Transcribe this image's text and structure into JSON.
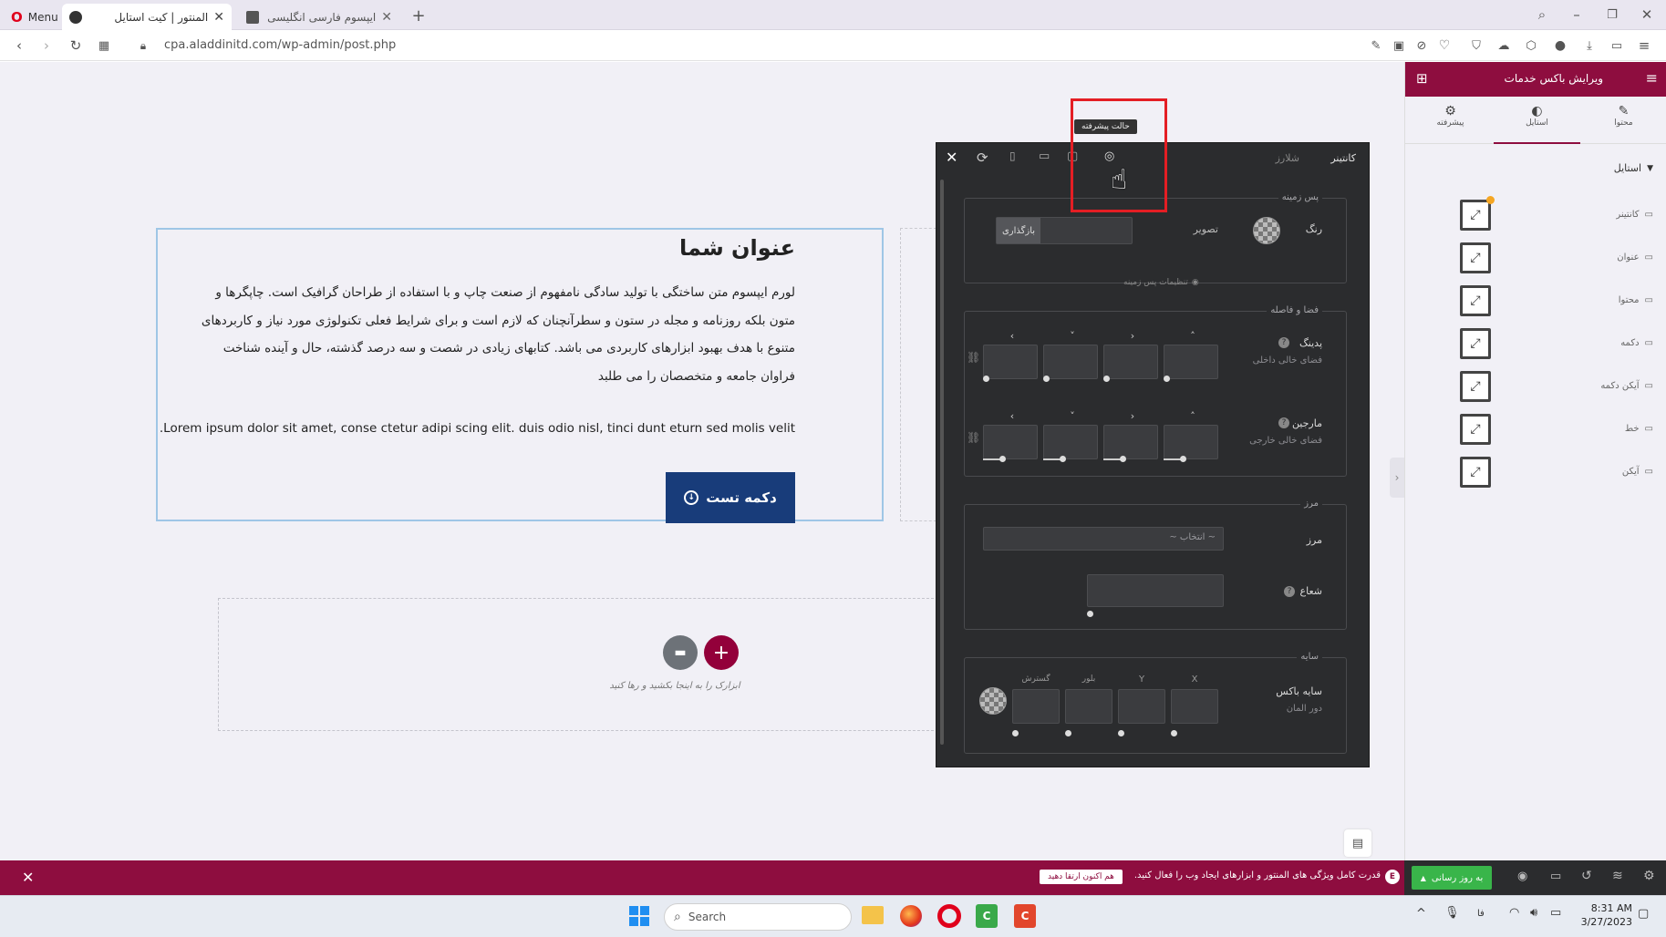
{
  "browser": {
    "menu_label": "Menu",
    "tabs": [
      {
        "label": "المنتور | کیت استایل"
      },
      {
        "label": "ایپسوم فارسی انگلیسی عربی"
      }
    ],
    "url": "cpa.aladdinitd.com/wp-admin/post.php"
  },
  "content": {
    "heading": "عنوان شما",
    "paragraph_lines": [
      "لورم ایپسوم متن ساختگی با تولید سادگی نامفهوم از صنعت چاپ و با استفاده از طراحان گرافیک است. چاپگرها و",
      "متون بلکه روزنامه و مجله در ستون و سطرآنچنان که لازم است و برای شرایط فعلی تکنولوژی مورد نیاز و کاربردهای",
      "متنوع با هدف بهبود ابزارهای کاربردی می باشد. کتابهای زیادی در شصت و سه درصد گذشته، حال و آینده شناخت",
      "فراوان جامعه و متخصصان را می طلبد"
    ],
    "latin_line": ".Lorem ipsum dolor sit amet, conse ctetur adipi scing elit. duis odio nisl, tinci dunt eturn sed molis velit",
    "button_label": "دکمه تست",
    "drop_hint": "ابزارک را به اینجا بکشید و رها کنید"
  },
  "modal": {
    "tab_container": "کانتینر",
    "tab_styler": "شلارز",
    "tooltip": "حالت پیشرفته",
    "background": {
      "title": "پس زمینه",
      "color_label": "رنگ",
      "image_label": "تصویر",
      "reset_label": "بازگذاری",
      "settings_note": "تنظیمات پس زمینه"
    },
    "spacing": {
      "title": "فضا و فاصله",
      "padding_label": "پدینگ",
      "padding_sub": "فضای خالی داخلی",
      "margin_label": "مارجین",
      "margin_sub": "فضای خالی خارجی",
      "arrows": [
        "‹",
        "˅",
        "›",
        "˄"
      ]
    },
    "border": {
      "title": "مرز",
      "border_label": "مرز",
      "select_value": "~ انتخاب ~",
      "radius_label": "شعاع"
    },
    "shadow": {
      "title": "سایه",
      "label": "سایه باکس",
      "sub": "دور المان",
      "cols": [
        "گسترش",
        "بلور",
        "Y",
        "X"
      ]
    }
  },
  "panel": {
    "title": "ویرایش باکس خدمات",
    "tabs": [
      "محتوا",
      "استایل",
      "پیشرفته"
    ],
    "section": "استایل",
    "items": [
      {
        "label": "کانتینر",
        "badge": true
      },
      {
        "label": "عنوان"
      },
      {
        "label": "محتوا"
      },
      {
        "label": "دکمه"
      },
      {
        "label": "آیکن دکمه"
      },
      {
        "label": "خط"
      },
      {
        "label": "آیکن"
      }
    ]
  },
  "notice": {
    "text": "قدرت کامل ویژگی های المنتور و ابزارهای ایجاد وب را فعال کنید.",
    "cta": "هم اکنون ارتقا دهید",
    "update_button": "به روز رسانی"
  },
  "taskbar": {
    "search": "Search",
    "lang": "فا",
    "time": "8:31 AM",
    "date": "3/27/2023"
  },
  "colors": {
    "brand": "#8e0d3f",
    "button": "#183c7a",
    "modal_bg": "#2b2c2e",
    "highlight": "#e41e24",
    "green": "#39b54a"
  }
}
